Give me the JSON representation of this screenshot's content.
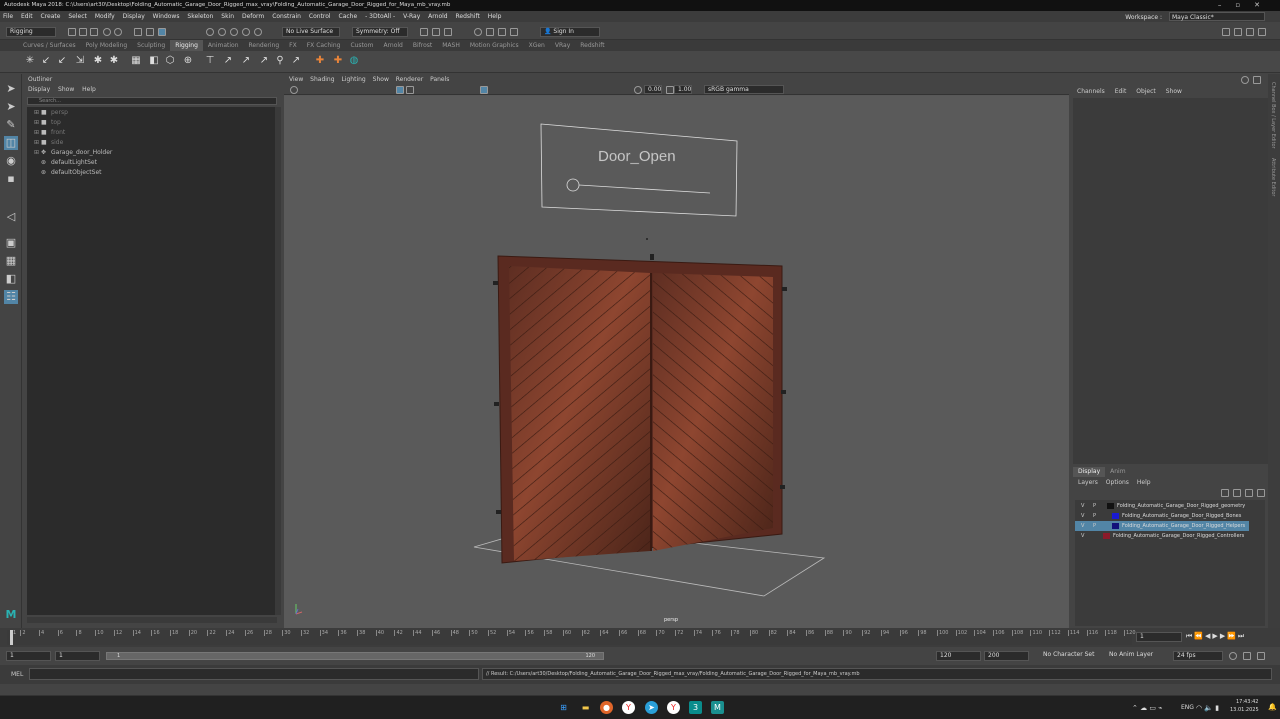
{
  "window": {
    "title": "Autodesk Maya 2018: C:\\Users\\art30\\Desktop\\Folding_Automatic_Garage_Door_Rigged_max_vray\\Folding_Automatic_Garage_Door_Rigged_for_Maya_mb_vray.mb"
  },
  "menubar": {
    "items": [
      "File",
      "Edit",
      "Create",
      "Select",
      "Modify",
      "Display",
      "Windows",
      "Skeleton",
      "Skin",
      "Deform",
      "Constrain",
      "Control",
      "Cache",
      "- 3DtoAll -",
      "V-Ray",
      "Arnold",
      "Redshift",
      "Help"
    ]
  },
  "workspace": {
    "label": "Workspace :",
    "value": "Maya Classic*"
  },
  "status": {
    "mode": "Rigging",
    "live_surface": "No Live Surface",
    "symmetry": "Symmetry: Off",
    "sign_in": "Sign In"
  },
  "shelf": {
    "tabs": [
      "Curves / Surfaces",
      "Poly Modeling",
      "Sculpting",
      "Rigging",
      "Animation",
      "Rendering",
      "FX",
      "FX Caching",
      "Custom",
      "Arnold",
      "Bifrost",
      "MASH",
      "Motion Graphics",
      "XGen",
      "VRay",
      "Redshift"
    ],
    "active": "Rigging"
  },
  "outliner": {
    "title": "Outliner",
    "menu": [
      "Display",
      "Show",
      "Help"
    ],
    "search_placeholder": "Search...",
    "items": [
      {
        "label": "persp",
        "dim": true,
        "icon": "camera-icon"
      },
      {
        "label": "top",
        "dim": true,
        "icon": "camera-icon"
      },
      {
        "label": "front",
        "dim": true,
        "icon": "camera-icon"
      },
      {
        "label": "side",
        "dim": true,
        "icon": "camera-icon"
      },
      {
        "label": "Garage_door_Holder",
        "dim": false,
        "icon": "locator-icon"
      },
      {
        "label": "defaultLightSet",
        "dim": false,
        "icon": "set-icon"
      },
      {
        "label": "defaultObjectSet",
        "dim": false,
        "icon": "set-icon"
      }
    ]
  },
  "viewport": {
    "menu": [
      "View",
      "Shading",
      "Lighting",
      "Show",
      "Renderer",
      "Panels"
    ],
    "exposure": "0.00",
    "gamma": "1.00",
    "colorspace": "sRGB gamma",
    "camera_label": "persp",
    "control_label": "Door_Open"
  },
  "channelbox": {
    "menu": [
      "Channels",
      "Edit",
      "Object",
      "Show"
    ]
  },
  "sidetabs": [
    "Channel Box / Layer Editor",
    "Attribute Editor"
  ],
  "layers": {
    "tabs": [
      "Display",
      "Anim"
    ],
    "menu": [
      "Layers",
      "Options",
      "Help"
    ],
    "rows": [
      {
        "v": "V",
        "p": "P",
        "color": "#111111",
        "name": "Folding_Automatic_Garage_Door_Rigged_geometry",
        "selected": false
      },
      {
        "v": "V",
        "p": "P",
        "color": "#1a1ad0",
        "name": "Folding_Automatic_Garage_Door_Rigged_Bones",
        "selected": false
      },
      {
        "v": "V",
        "p": "P",
        "color": "#12127a",
        "name": "Folding_Automatic_Garage_Door_Rigged_Helpers",
        "selected": true
      },
      {
        "v": "V",
        "p": "",
        "color": "#8b1a2a",
        "name": "Folding_Automatic_Garage_Door_Rigged_Controllers",
        "selected": false
      }
    ]
  },
  "timeline": {
    "ticks": [
      "1",
      "2",
      "4",
      "6",
      "8",
      "10",
      "12",
      "14",
      "16",
      "18",
      "20",
      "22",
      "24",
      "26",
      "28",
      "30",
      "32",
      "34",
      "36",
      "38",
      "40",
      "42",
      "44",
      "46",
      "48",
      "50",
      "52",
      "54",
      "56",
      "58",
      "60",
      "62",
      "64",
      "66",
      "68",
      "70",
      "72",
      "74",
      "76",
      "78",
      "80",
      "82",
      "84",
      "86",
      "88",
      "90",
      "92",
      "94",
      "96",
      "98",
      "100",
      "102",
      "104",
      "106",
      "108",
      "110",
      "112",
      "114",
      "116",
      "118",
      "120"
    ],
    "current_frame": "1"
  },
  "range": {
    "start": "1",
    "playback_start": "1",
    "slider_start": "1",
    "slider_end": "120",
    "playback_end": "120",
    "end": "200",
    "character_set": "No Character Set",
    "anim_layer": "No Anim Layer",
    "fps": "24 fps"
  },
  "commandline": {
    "label": "MEL",
    "result": "// Result: C:/Users/art30/Desktop/Folding_Automatic_Garage_Door_Rigged_max_vray/Folding_Automatic_Garage_Door_Rigged_for_Maya_mb_vray.mb"
  },
  "taskbar": {
    "lang": "ENG",
    "time": "17:43:42",
    "date": "13.01.2025"
  }
}
